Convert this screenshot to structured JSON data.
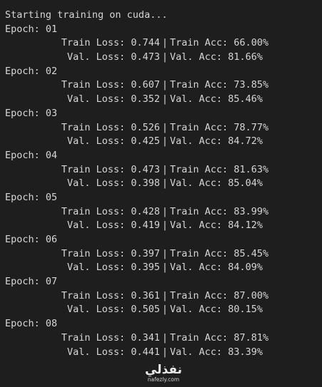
{
  "header": "Starting training on cuda...",
  "epochs": [
    {
      "label": "Epoch: 01",
      "train_loss": "0.744",
      "train_acc": "66.00%",
      "val_loss": "0.473",
      "val_acc": "81.66%"
    },
    {
      "label": "Epoch: 02",
      "train_loss": "0.607",
      "train_acc": "73.85%",
      "val_loss": "0.352",
      "val_acc": "85.46%"
    },
    {
      "label": "Epoch: 03",
      "train_loss": "0.526",
      "train_acc": "78.77%",
      "val_loss": "0.425",
      "val_acc": "84.72%"
    },
    {
      "label": "Epoch: 04",
      "train_loss": "0.473",
      "train_acc": "81.63%",
      "val_loss": "0.398",
      "val_acc": "85.04%"
    },
    {
      "label": "Epoch: 05",
      "train_loss": "0.428",
      "train_acc": "83.99%",
      "val_loss": "0.419",
      "val_acc": "84.12%"
    },
    {
      "label": "Epoch: 06",
      "train_loss": "0.397",
      "train_acc": "85.45%",
      "val_loss": "0.395",
      "val_acc": "84.09%"
    },
    {
      "label": "Epoch: 07",
      "train_loss": "0.361",
      "train_acc": "87.00%",
      "val_loss": "0.505",
      "val_acc": "80.15%"
    },
    {
      "label": "Epoch: 08",
      "train_loss": "0.341",
      "train_acc": "87.81%",
      "val_loss": "0.441",
      "val_acc": "83.39%"
    }
  ],
  "labels": {
    "train_loss": "Train Loss:",
    "train_acc": "Train Acc:",
    "val_loss": "Val. Loss:",
    "val_acc": "Val. Acc:",
    "separator": "|"
  },
  "watermark": {
    "logo": "نفذلي",
    "url": "nafezly.com"
  },
  "colors": {
    "background": "#1e1e1e",
    "text": "#d6d6d6"
  }
}
